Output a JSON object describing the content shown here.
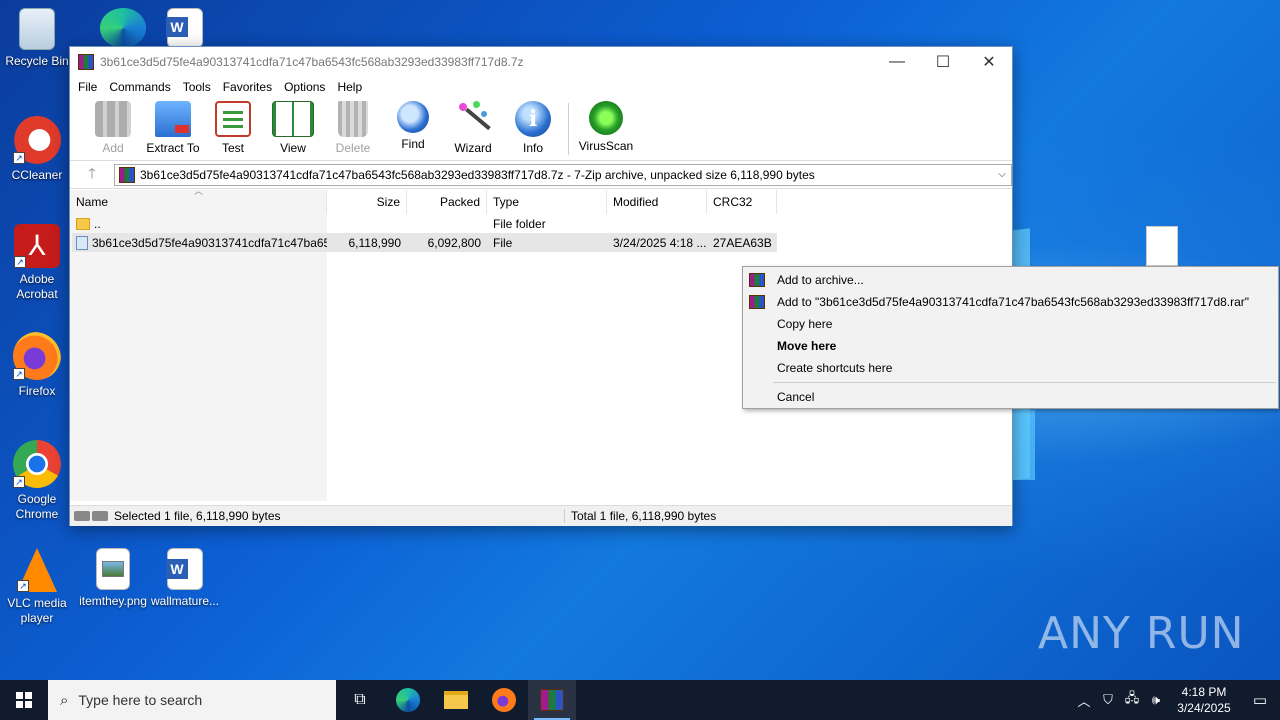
{
  "desktop": {
    "icons": [
      {
        "label": "Recycle Bin"
      },
      {
        "label": "CCleaner"
      },
      {
        "label": "Adobe Acrobat"
      },
      {
        "label": "Firefox"
      },
      {
        "label": "Google Chrome"
      },
      {
        "label": "VLC media player"
      },
      {
        "label": "itemthey.png"
      },
      {
        "label": "wallmature..."
      }
    ]
  },
  "window": {
    "title": "3b61ce3d5d75fe4a90313741cdfa71c47ba6543fc568ab3293ed33983ff717d8.7z",
    "controls": {
      "minimize": "—",
      "maximize": "☐",
      "close": "✕"
    }
  },
  "menubar": [
    "File",
    "Commands",
    "Tools",
    "Favorites",
    "Options",
    "Help"
  ],
  "toolbar": [
    {
      "label": "Add",
      "icon": "add-archive-icon",
      "disabled": true
    },
    {
      "label": "Extract To",
      "icon": "extract-folder-icon",
      "disabled": false
    },
    {
      "label": "Test",
      "icon": "test-clipboard-icon",
      "disabled": false
    },
    {
      "label": "View",
      "icon": "view-book-icon",
      "disabled": false
    },
    {
      "label": "Delete",
      "icon": "trash-icon",
      "disabled": true
    },
    {
      "label": "Find",
      "icon": "magnifier-icon",
      "disabled": false
    },
    {
      "label": "Wizard",
      "icon": "wand-icon",
      "disabled": false
    },
    {
      "label": "Info",
      "icon": "info-icon",
      "disabled": false
    },
    {
      "label": "VirusScan",
      "icon": "virus-scan-icon",
      "disabled": false
    }
  ],
  "address": {
    "up": "🡑",
    "text": "3b61ce3d5d75fe4a90313741cdfa71c47ba6543fc568ab3293ed33983ff717d8.7z - 7-Zip archive, unpacked size 6,118,990 bytes"
  },
  "filelist": {
    "columns": [
      "Name",
      "Size",
      "Packed",
      "Type",
      "Modified",
      "CRC32"
    ],
    "rows": [
      {
        "name": "..",
        "size": "",
        "packed": "",
        "type": "File folder",
        "modified": "",
        "crc": ""
      },
      {
        "name": "3b61ce3d5d75fe4a90313741cdfa71c47ba65...",
        "size": "6,118,990",
        "packed": "6,092,800",
        "type": "File",
        "modified": "3/24/2025 4:18 ...",
        "crc": "27AEA63B"
      }
    ]
  },
  "statusbar": {
    "left": "Selected 1 file, 6,118,990 bytes",
    "right": "Total 1 file, 6,118,990 bytes"
  },
  "context_menu": [
    {
      "label": "Add to archive...",
      "icon": true,
      "bold": false
    },
    {
      "label": "Add to \"3b61ce3d5d75fe4a90313741cdfa71c47ba6543fc568ab3293ed33983ff717d8.rar\"",
      "icon": true,
      "bold": false
    },
    {
      "label": "Copy here",
      "icon": false,
      "bold": false
    },
    {
      "label": "Move here",
      "icon": false,
      "bold": true
    },
    {
      "label": "Create shortcuts here",
      "icon": false,
      "bold": false
    },
    {
      "label": "Cancel",
      "icon": false,
      "bold": false
    }
  ],
  "taskbar": {
    "search_placeholder": "Type here to search",
    "time": "4:18 PM",
    "date": "3/24/2025"
  },
  "watermark": "ANY RUN"
}
